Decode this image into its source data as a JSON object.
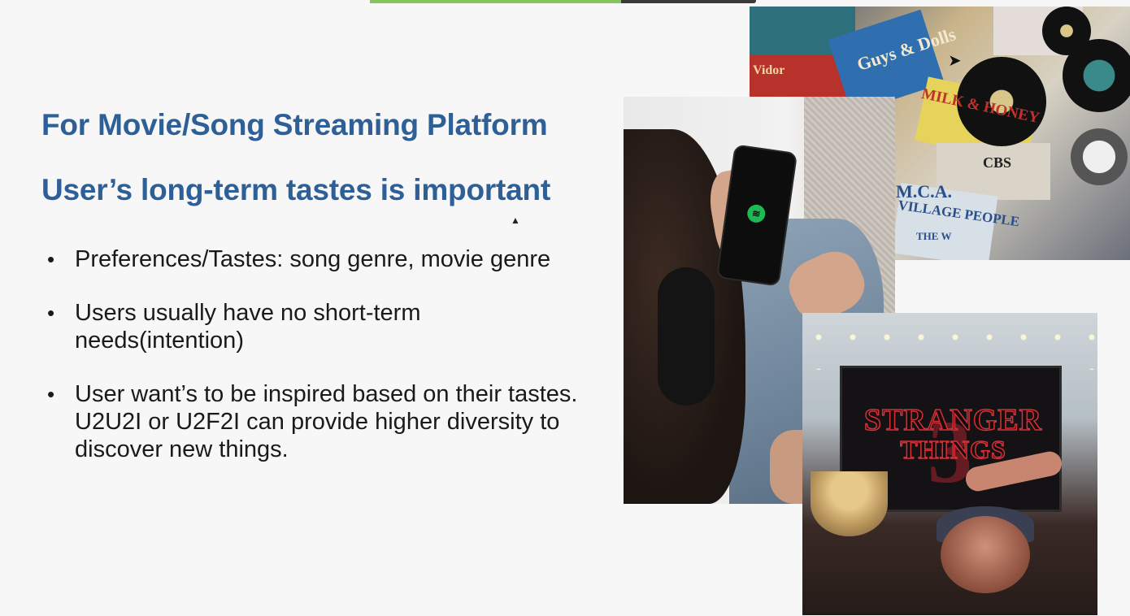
{
  "video_progress": {
    "fraction": 0.65,
    "fill_color": "#86c35a",
    "track_color": "#3a3a3a"
  },
  "slide": {
    "title": "For Movie/Song Streaming Platform",
    "subtitle": "User’s long-term tastes is important",
    "title_color": "#2e5f96",
    "bullet_glyph": "•",
    "bullets": [
      "Preferences/Tastes: song genre, movie genre",
      "Users usually have no short-term needs(intention)",
      "User want’s to be inspired based on their tastes. U2U2I or U2F2I can provide higher diversity to discover new things."
    ]
  },
  "images": {
    "vinyl": {
      "labels": [
        "Guys & Dolls",
        "MILK & HONEY",
        "CBS",
        "M.C.A.",
        "VILLAGE PEOPLE",
        "THE W",
        "Vidor"
      ]
    },
    "phone": {
      "icon": "spotify-icon",
      "brand_color": "#1db954"
    },
    "tv": {
      "title_line_1": "STRANGER",
      "title_line_2": "THINGS",
      "number": "3",
      "accent_color": "#d2313a"
    }
  }
}
